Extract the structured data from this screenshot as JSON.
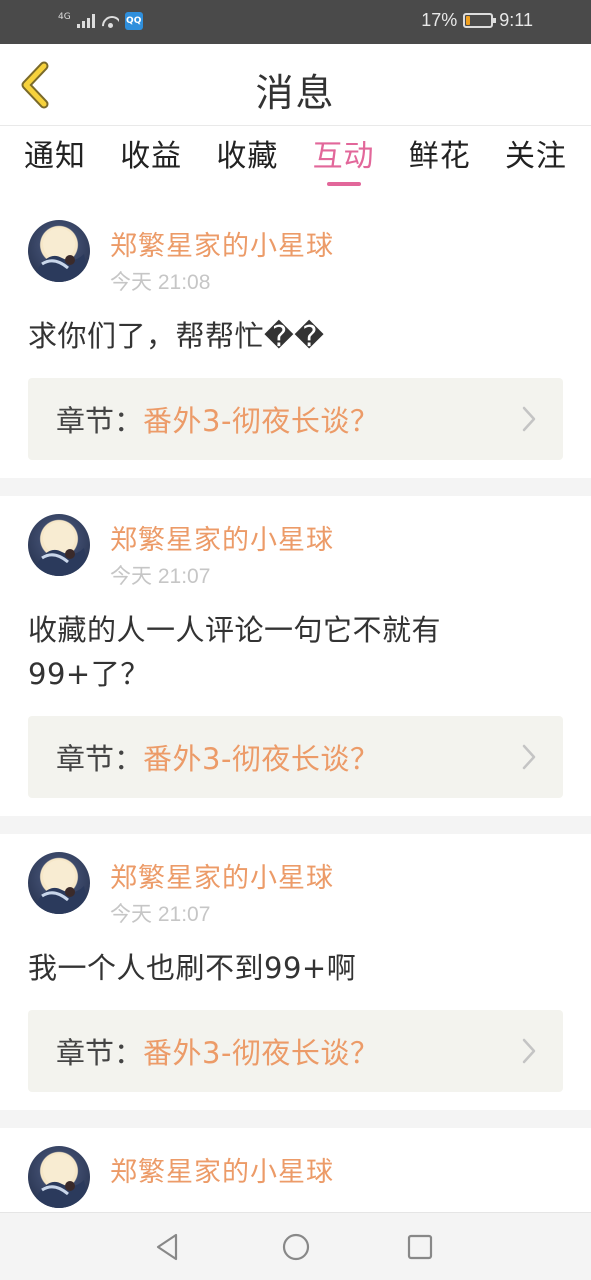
{
  "status_bar": {
    "network": "4G",
    "app_badge": "QQ",
    "battery_percent": "17%",
    "battery_level": 0.17,
    "time": "9:11"
  },
  "header": {
    "title": "消息",
    "back_icon": "chevron-left-icon"
  },
  "tabs": [
    {
      "label": "通知"
    },
    {
      "label": "收益"
    },
    {
      "label": "收藏"
    },
    {
      "label": "互动",
      "active": true
    },
    {
      "label": "鲜花"
    },
    {
      "label": "关注"
    }
  ],
  "colors": {
    "accent": "#e2679a",
    "author": "#ec9b68",
    "chapter_bg": "#f3f3ee"
  },
  "messages": [
    {
      "author": "郑繁星家的小星球",
      "time": "今天 21:08",
      "comment": "求你们了，帮帮忙��",
      "chapter_label": "章节：",
      "chapter_title": "番外3-彻夜长谈？"
    },
    {
      "author": "郑繁星家的小星球",
      "time": "今天 21:07",
      "comment": "收藏的人一人评论一句它不就有99+了？",
      "chapter_label": "章节：",
      "chapter_title": "番外3-彻夜长谈？"
    },
    {
      "author": "郑繁星家的小星球",
      "time": "今天 21:07",
      "comment": "我一个人也刷不到99+啊",
      "chapter_label": "章节：",
      "chapter_title": "番外3-彻夜长谈？"
    },
    {
      "author": "郑繁星家的小星球"
    }
  ],
  "nav": {
    "back_icon": "triangle-back-icon",
    "home_icon": "circle-home-icon",
    "recents_icon": "square-recents-icon"
  }
}
